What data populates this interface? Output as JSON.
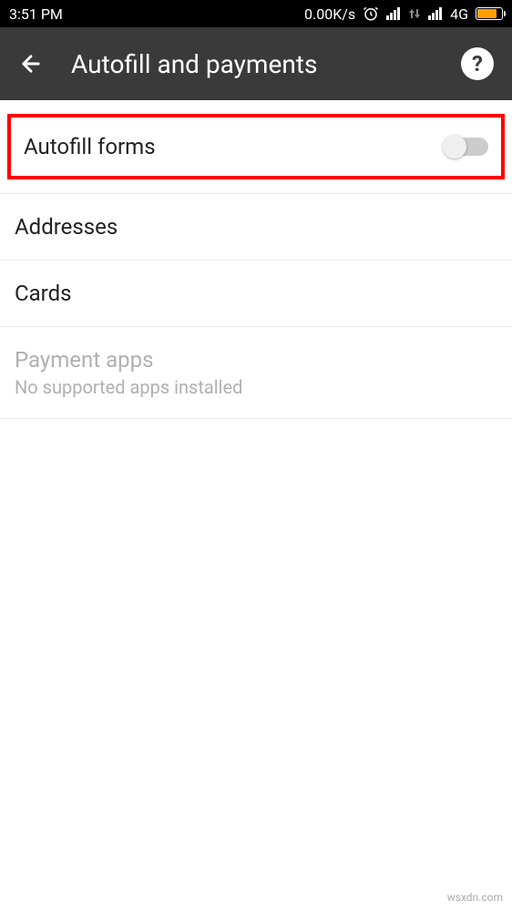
{
  "status_bar": {
    "time": "3:51 PM",
    "data_rate": "0.00K/s",
    "network_label": "4G"
  },
  "app_bar": {
    "title": "Autofill and payments"
  },
  "items": {
    "autofill_forms": {
      "label": "Autofill forms"
    },
    "addresses": {
      "label": "Addresses"
    },
    "cards": {
      "label": "Cards"
    },
    "payment_apps": {
      "label": "Payment apps",
      "subtitle": "No supported apps installed"
    }
  },
  "watermark": "wsxdn.com"
}
